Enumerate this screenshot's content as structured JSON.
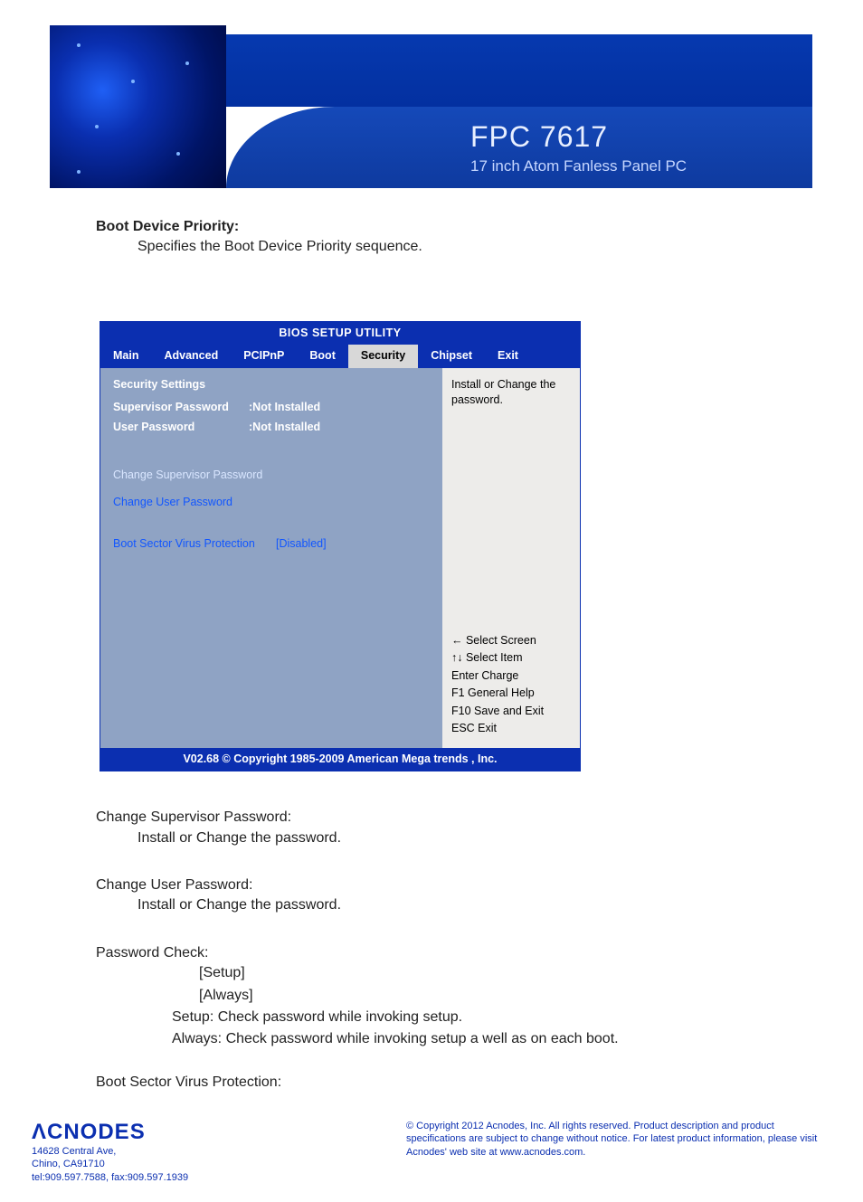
{
  "header": {
    "title": "FPC 7617",
    "subtitle": "17 inch Atom Fanless Panel PC"
  },
  "sections": {
    "boot_device_priority": {
      "title": "Boot Device Priority:",
      "body": "Specifies the Boot Device Priority sequence."
    },
    "change_supervisor": {
      "title": "Change Supervisor Password:",
      "body": "Install or Change the password."
    },
    "change_user": {
      "title": "Change User Password:",
      "body": "Install or Change the password."
    },
    "password_check": {
      "title": "Password Check:",
      "options": [
        "[Setup]",
        "[Always]"
      ],
      "setup_expl": "Setup: Check password while invoking setup.",
      "always_expl": "Always: Check password while invoking setup a well as on each boot."
    },
    "boot_sector_virus": {
      "title": "Boot Sector Virus Protection:"
    }
  },
  "bios": {
    "title": "BIOS SETUP UTILITY",
    "tabs": [
      "Main",
      "Advanced",
      "PCIPnP",
      "Boot",
      "Security",
      "Chipset",
      "Exit"
    ],
    "active_tab": "Security",
    "left": {
      "heading": "Security Settings",
      "rows": [
        {
          "label": "Supervisor Password",
          "value": ":Not Installed"
        },
        {
          "label": "User Password",
          "value": ":Not Installed"
        }
      ],
      "link1": "Change Supervisor Password",
      "link2": "Change User Password",
      "bsvp_label": "Boot Sector Virus Protection",
      "bsvp_value": "[Disabled]"
    },
    "right": {
      "help_top": "Install or Change the password.",
      "keys": [
        "←     Select Screen",
        "↑↓     Select Item",
        "Enter Charge",
        "F1     General Help",
        "F10   Save and Exit",
        "ESC   Exit"
      ]
    },
    "footer": "V02.68 © Copyright 1985-2009 American Mega trends , Inc."
  },
  "footer": {
    "logo": "CNODES",
    "address": "14628 Central Ave,\nChino, CA91710\ntel:909.597.7588, fax:909.597.1939",
    "copyright": "© Copyright 2012 Acnodes, Inc.\nAll rights reserved. Product description and product specifications are subject to change without notice. For latest product information, please visit Acnodes' web site at www.acnodes.com."
  }
}
